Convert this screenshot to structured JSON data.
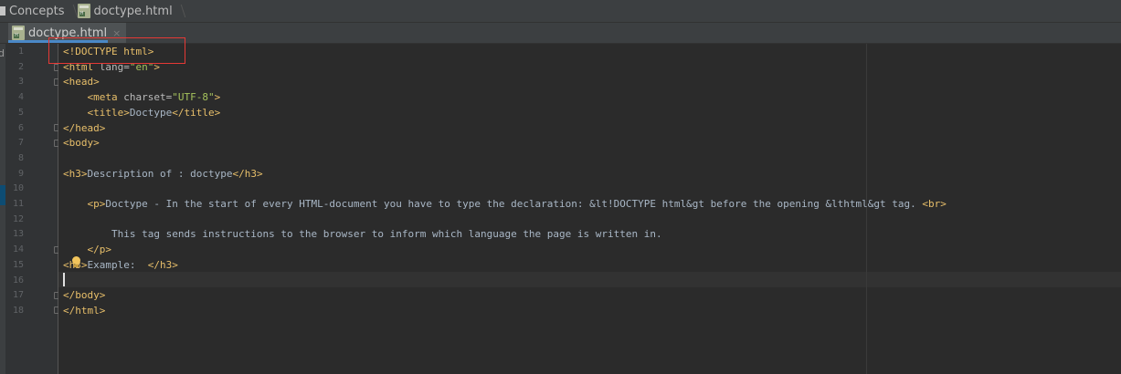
{
  "breadcrumb": {
    "project": "Concepts",
    "file": "doctype.html"
  },
  "tab": {
    "label": "doctype.html",
    "close": "×"
  },
  "left_strip": {
    "letter": "d"
  },
  "gutter": {
    "line_numbers": [
      "1",
      "2",
      "3",
      "4",
      "5",
      "6",
      "7",
      "8",
      "9",
      "10",
      "11",
      "12",
      "13",
      "14",
      "15",
      "16",
      "17",
      "18"
    ]
  },
  "code": {
    "l1": "<!DOCTYPE html>",
    "l2_open": "<html ",
    "l2_attr": "lang=",
    "l2_val": "\"en\"",
    "l2_close": ">",
    "l3": "<head>",
    "l4_open": "    <meta ",
    "l4_attr": "charset=",
    "l4_val": "\"UTF-8\"",
    "l4_close": ">",
    "l5_open": "    <title>",
    "l5_text": "Doctype",
    "l5_close": "</title>",
    "l6": "</head>",
    "l7": "<body>",
    "l9_open": "<h3>",
    "l9_text": "Description of : doctype",
    "l9_close": "</h3>",
    "l11_open": "    <p>",
    "l11_text": "Doctype - In the start of every HTML-document you have to type the declaration: &lt!DOCTYPE html&gt before the opening &lthtml&gt tag. ",
    "l11_br": "<br>",
    "l13_text": "        This tag sends instructions to the browser to inform which language the page is written in.",
    "l14": "    </p>",
    "l15_open": "<h3>",
    "l15_text": "Example:  ",
    "l15_close": "</h3>",
    "l17": "</body>",
    "l18": "</html>"
  },
  "colors": {
    "tag": "#e8bf6a",
    "attribute_value": "#a5c25c",
    "text": "#a9b7c6",
    "highlight_box": "#e53935",
    "active_tab_underline": "#4a88c7"
  }
}
